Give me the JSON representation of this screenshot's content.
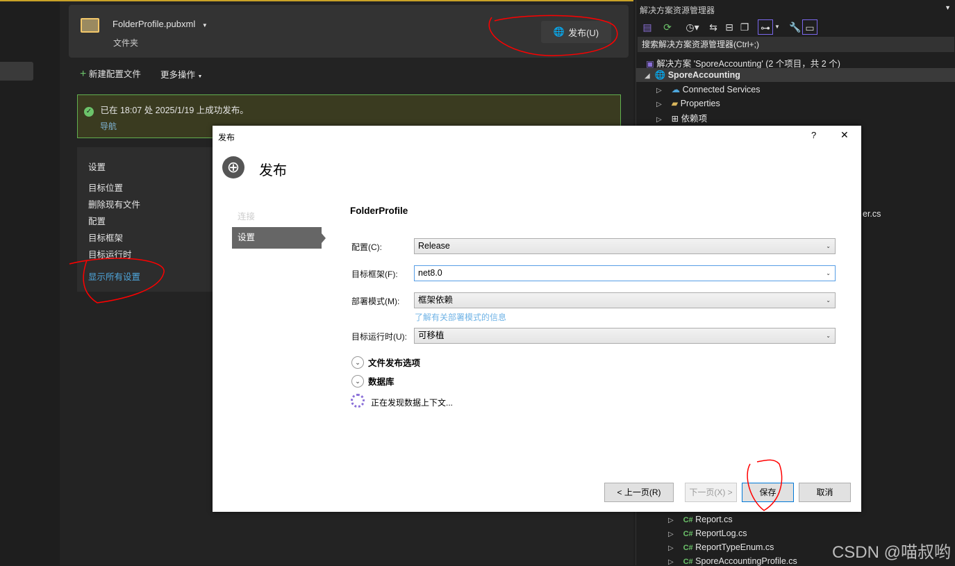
{
  "profile": {
    "name": "FolderProfile.pubxml",
    "type": "文件夹",
    "publish_button": "发布(U)"
  },
  "toolbar": {
    "new_profile": "新建配置文件",
    "more_actions": "更多操作"
  },
  "status": {
    "message": "已在 18:07 处 2025/1/19 上成功发布。",
    "link": "导航"
  },
  "settings": {
    "title": "设置",
    "items": [
      "目标位置",
      "删除现有文件",
      "配置",
      "目标框架",
      "目标运行时"
    ],
    "show_all": "显示所有设置"
  },
  "solution_explorer": {
    "title": "解决方案资源管理器",
    "search_placeholder": "搜索解决方案资源管理器(Ctrl+;)",
    "solution": "解决方案 'SporeAccounting' (2 个项目，共 2 个)",
    "project": "SporeAccounting",
    "items": [
      "Connected Services",
      "Properties",
      "依赖项"
    ],
    "partial_item": "er.cs",
    "files": [
      "Report.cs",
      "ReportLog.cs",
      "ReportTypeEnum.cs",
      "SporeAccountingProfile.cs"
    ],
    "cs_badge": "C#"
  },
  "dialog": {
    "title": "发布",
    "help": "?",
    "close": "✕",
    "heading": "发布",
    "nav": [
      "连接",
      "设置"
    ],
    "profile_name": "FolderProfile",
    "fields": [
      {
        "label": "配置(C):",
        "value": "Release"
      },
      {
        "label": "目标框架(F):",
        "value": "net8.0"
      },
      {
        "label": "部署模式(M):",
        "value": "框架依赖"
      },
      {
        "label": "目标运行时(U):",
        "value": "可移植"
      }
    ],
    "deploy_link": "了解有关部署模式的信息",
    "sections": [
      "文件发布选项",
      "数据库"
    ],
    "loading": "正在发现数据上下文...",
    "buttons": {
      "prev": "< 上一页(R)",
      "next": "下一页(X) >",
      "save": "保存",
      "cancel": "取消"
    }
  },
  "watermark": "CSDN @喵叔哟",
  "colors": {
    "accent": "#7b68ee",
    "success": "#6cc36a",
    "link": "#4ea6dc",
    "annotation": "#ff0000"
  }
}
